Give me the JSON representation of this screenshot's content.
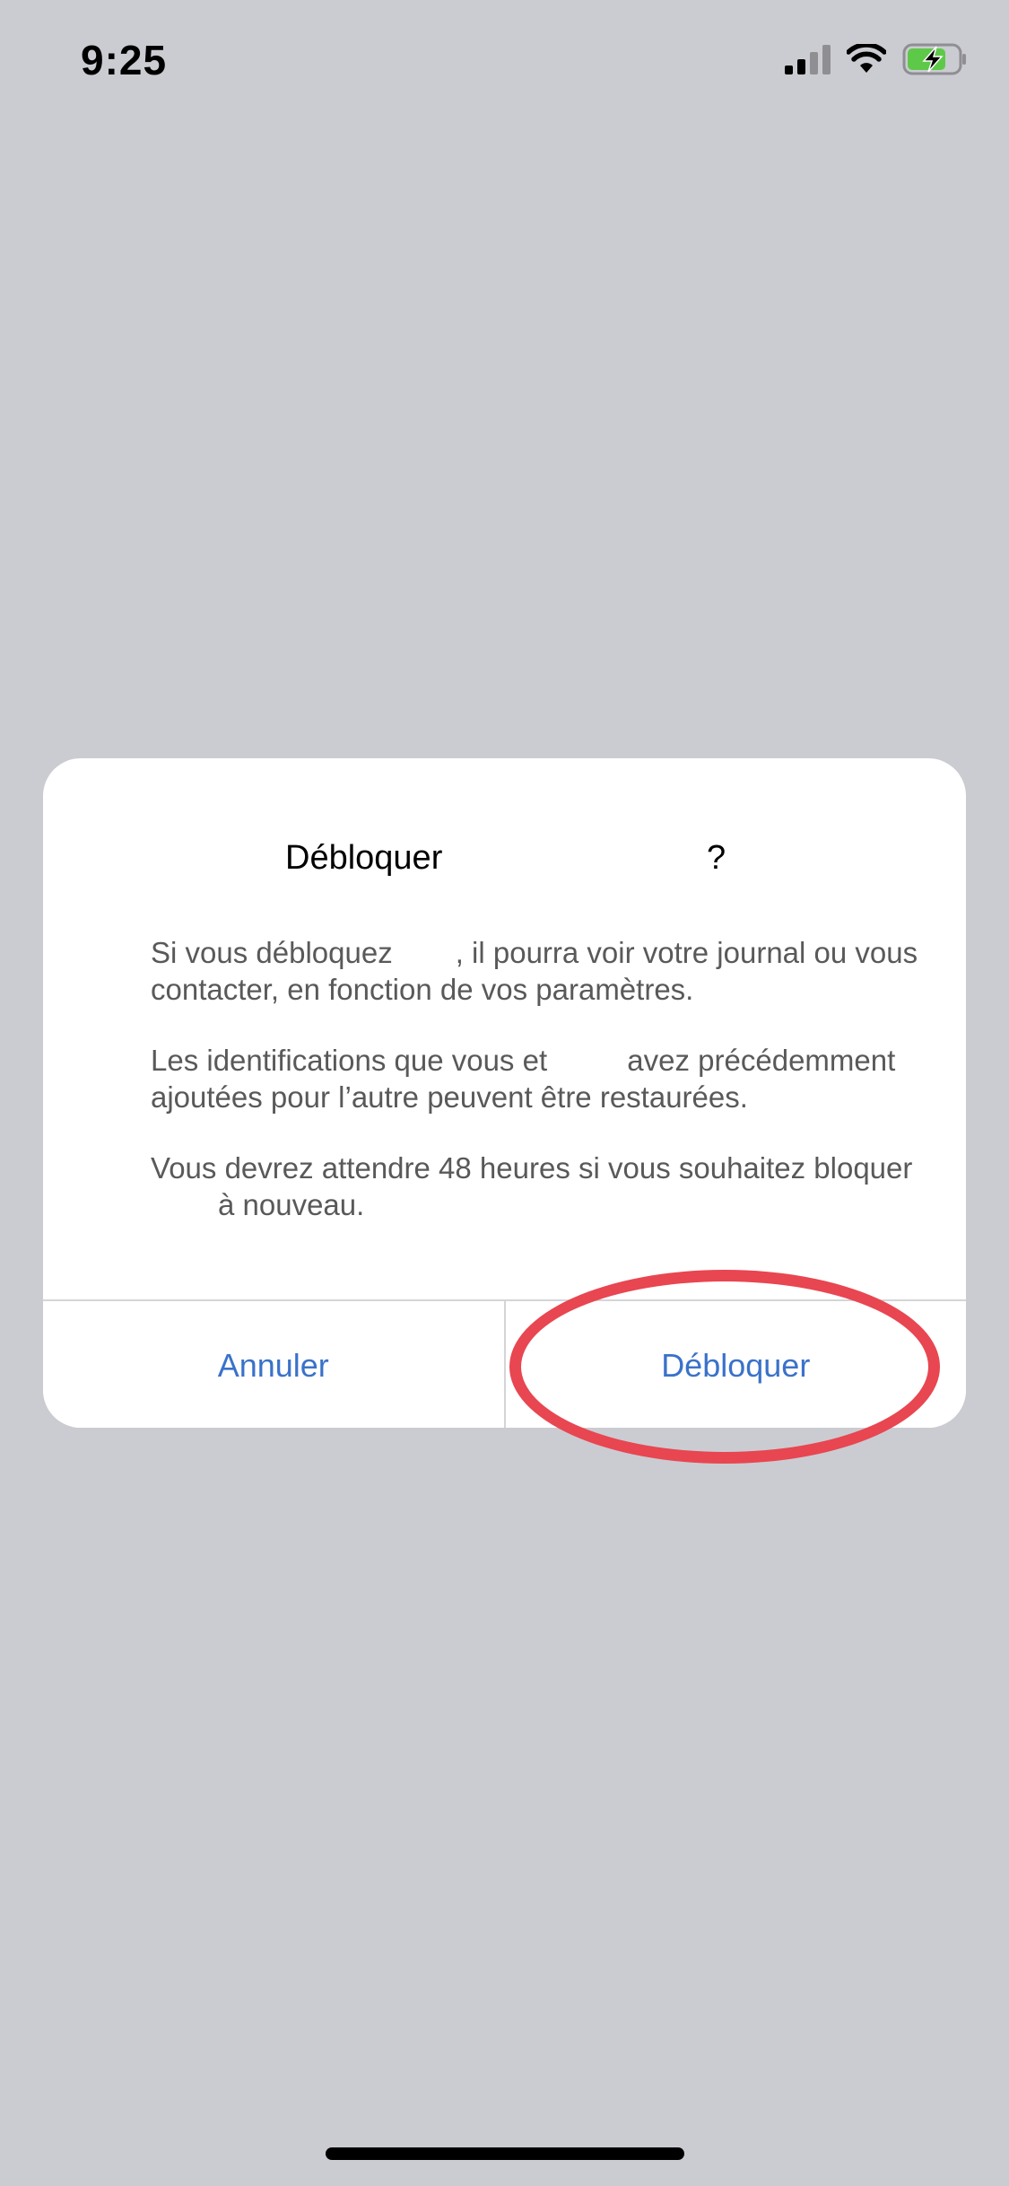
{
  "status_bar": {
    "time": "9:25",
    "icons": [
      "cellular-signal-icon",
      "wifi-icon",
      "battery-charging-icon"
    ],
    "battery_color": "#5ec949"
  },
  "dialog": {
    "title_word": "Débloquer",
    "title_suffix": "?",
    "paragraphs": [
      {
        "a": "Si vous débloquez",
        "b": ", il pourra voir votre journal ou vous contacter, en fonction de vos paramètres."
      },
      {
        "a": "Les identifications que vous et",
        "b": "avez précédemment ajoutées pour l’autre peuvent être restaurées."
      },
      {
        "a": "Vous devrez attendre 48 heures si vous souhaitez bloquer",
        "b": "à nouveau."
      }
    ],
    "cancel_label": "Annuler",
    "confirm_label": "Débloquer"
  },
  "colors": {
    "background": "#cbccd1",
    "button_text": "#3a72c9",
    "annotation": "#e84651"
  }
}
